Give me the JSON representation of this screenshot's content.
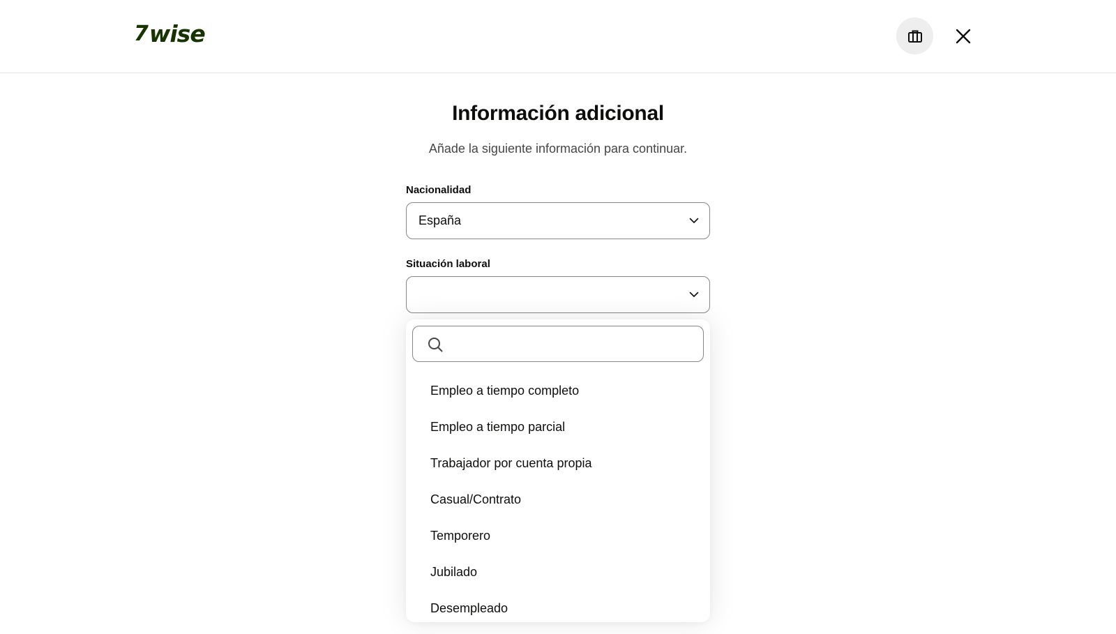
{
  "header": {
    "logo_mark": "7",
    "logo_text": "wise",
    "briefcase_icon": "briefcase-icon",
    "close_icon": "close-icon"
  },
  "page": {
    "title": "Información adicional",
    "subtitle": "Añade la siguiente información para continuar."
  },
  "form": {
    "nationality": {
      "label": "Nacionalidad",
      "value": "España"
    },
    "employment": {
      "label": "Situación laboral",
      "value": ""
    }
  },
  "dropdown": {
    "search_placeholder": "",
    "search_value": "",
    "options": [
      "Empleo a tiempo completo",
      "Empleo a tiempo parcial",
      "Trabajador por cuenta propia",
      "Casual/Contrato",
      "Temporero",
      "Jubilado",
      "Desempleado"
    ]
  },
  "colors": {
    "brand_green": "#163300",
    "text": "#0e0f0c",
    "border": "#868685"
  }
}
